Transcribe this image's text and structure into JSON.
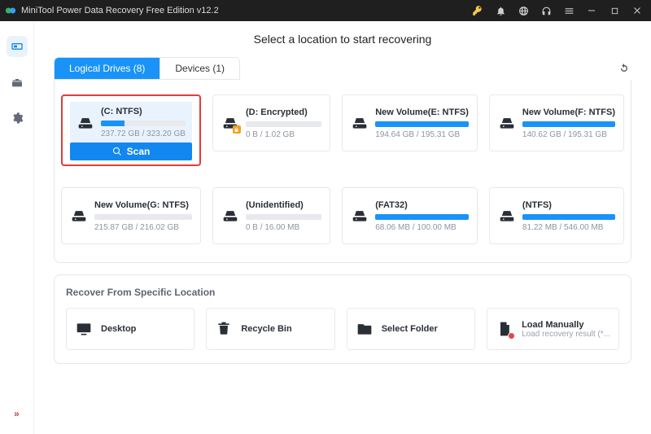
{
  "window": {
    "title": "MiniTool Power Data Recovery Free Edition v12.2"
  },
  "page": {
    "heading": "Select a location to start recovering"
  },
  "tabs": {
    "logical": "Logical Drives (8)",
    "devices": "Devices (1)"
  },
  "scan_label": "Scan",
  "drives": [
    {
      "name": "(C: NTFS)",
      "stats": "237.72 GB / 323.20 GB",
      "fill": 28,
      "selected": true,
      "locked": false
    },
    {
      "name": "(D: Encrypted)",
      "stats": "0 B / 1.02 GB",
      "fill": 0,
      "selected": false,
      "locked": true
    },
    {
      "name": "New Volume(E: NTFS)",
      "stats": "194.64 GB / 195.31 GB",
      "fill": 100,
      "selected": false,
      "locked": false
    },
    {
      "name": "New Volume(F: NTFS)",
      "stats": "140.62 GB / 195.31 GB",
      "fill": 100,
      "selected": false,
      "locked": false
    },
    {
      "name": "New Volume(G: NTFS)",
      "stats": "215.87 GB / 216.02 GB",
      "fill": 0,
      "selected": false,
      "locked": false
    },
    {
      "name": "(Unidentified)",
      "stats": "0 B / 16.00 MB",
      "fill": 0,
      "selected": false,
      "locked": false
    },
    {
      "name": "(FAT32)",
      "stats": "68.06 MB / 100.00 MB",
      "fill": 100,
      "selected": false,
      "locked": false
    },
    {
      "name": "(NTFS)",
      "stats": "81.22 MB / 546.00 MB",
      "fill": 100,
      "selected": false,
      "locked": false
    }
  ],
  "locations": {
    "title": "Recover From Specific Location",
    "items": [
      {
        "label": "Desktop",
        "sub": "",
        "icon": "monitor"
      },
      {
        "label": "Recycle Bin",
        "sub": "",
        "icon": "trash"
      },
      {
        "label": "Select Folder",
        "sub": "",
        "icon": "folder"
      },
      {
        "label": "Load Manually",
        "sub": "Load recovery result (*...",
        "icon": "doc-red"
      }
    ]
  }
}
